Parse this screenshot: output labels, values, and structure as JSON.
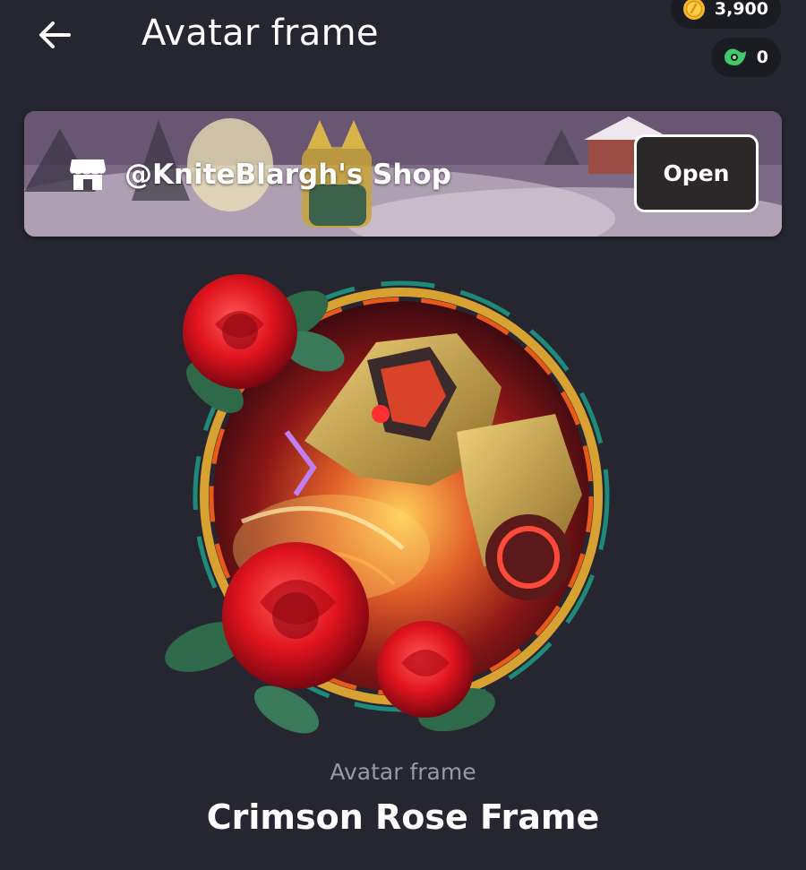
{
  "header": {
    "title": "Avatar frame",
    "back_icon": "arrow-left-icon"
  },
  "wallet": {
    "coins": "3,900",
    "coins_icon": "coin-icon",
    "props": "0",
    "props_icon": "props-icon"
  },
  "shop": {
    "name": "@KniteBlargh's Shop",
    "icon": "store-icon",
    "open_label": "Open"
  },
  "item": {
    "type_label": "Avatar frame",
    "name": "Crimson Rose Frame"
  },
  "colors": {
    "background": "#262630",
    "pill": "#1b1b22",
    "coin": "#f5b82e",
    "props": "#3ecb6a",
    "rose": "#e0141e",
    "muted_text": "#9a9aa6"
  }
}
